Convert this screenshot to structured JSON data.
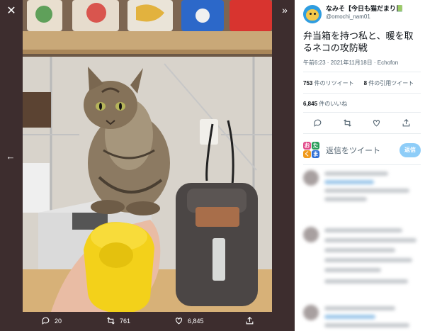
{
  "viewer": {
    "close_icon": "close-icon",
    "prev_icon": "arrow-left-icon",
    "collapse_icon": "chevron-double-right-icon",
    "actions": {
      "reply_count": "20",
      "retweet_count": "761",
      "like_count": "6,845"
    }
  },
  "tweet": {
    "display_name": "なみそ【今日も猫だまり📗",
    "handle": "@omochi_nam01",
    "text": "弁当箱を持つ私と、暖を取るネコの攻防戦",
    "timestamp": "午前6:23 · 2021年11月18日 · Echofon",
    "retweets_value": "753",
    "retweets_label": "件のリツイート",
    "quotes_value": "8",
    "quotes_label": "件の引用ツイート",
    "likes_value": "6,845",
    "likes_label": "件のいいね",
    "reply_placeholder": "返信をツイート",
    "reply_button": "返信",
    "my_avatar_letters": [
      "お",
      "た",
      "く",
      "ま"
    ]
  },
  "colors": {
    "viewer_bg": "#3d2d2e",
    "accent": "#1d9bf0",
    "reply_button_bg": "#8ecdf8"
  }
}
